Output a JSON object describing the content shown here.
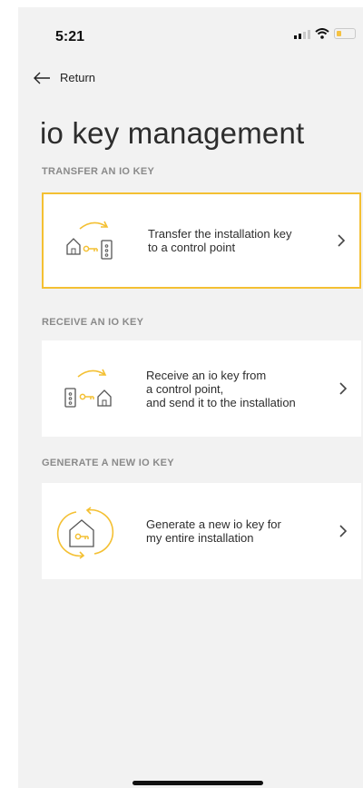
{
  "status": {
    "time": "5:21"
  },
  "nav": {
    "return_label": "Return"
  },
  "page": {
    "title": "io key management"
  },
  "sections": [
    {
      "title": "TRANSFER AN IO KEY",
      "card": {
        "text": "Transfer the installation key\nto a control point",
        "icon": "transfer-key-illustration"
      }
    },
    {
      "title": "RECEIVE AN IO KEY",
      "card": {
        "text": "Receive an io key from\na control point,\nand send it to the installation",
        "icon": "receive-key-illustration"
      }
    },
    {
      "title": "GENERATE A NEW IO KEY",
      "card": {
        "text": "Generate a new io key for\nmy entire installation",
        "icon": "generate-key-illustration"
      }
    }
  ],
  "colors": {
    "accent": "#f4c033",
    "background": "#f2f2f2",
    "card": "#ffffff",
    "section_text": "#8a8a8a"
  }
}
